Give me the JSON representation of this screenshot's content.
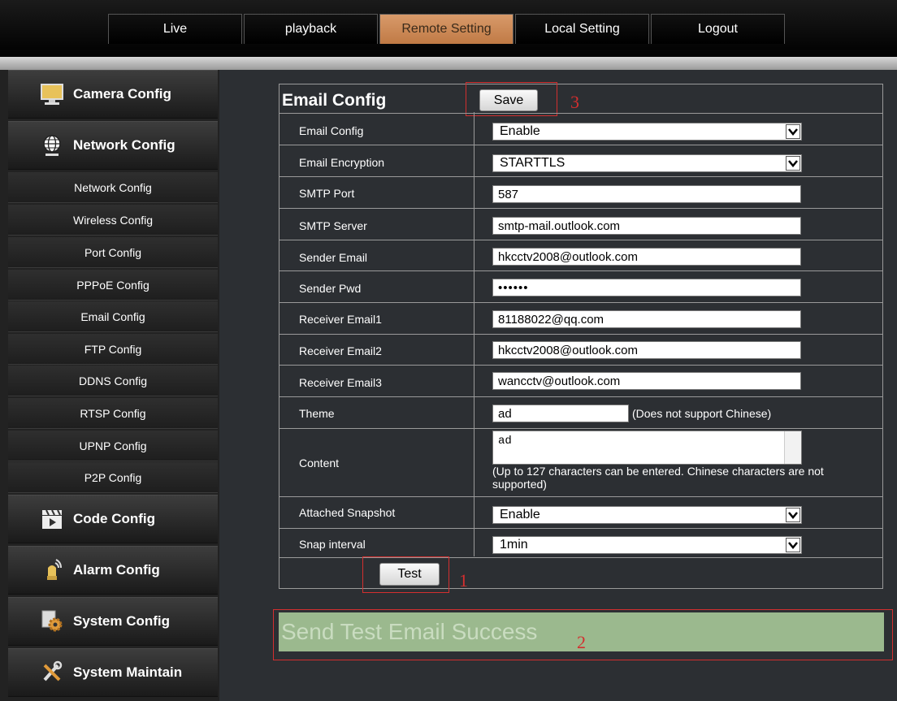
{
  "top_nav": [
    {
      "label": "Live"
    },
    {
      "label": "playback"
    },
    {
      "label": "Remote Setting",
      "active": true
    },
    {
      "label": "Local Setting"
    },
    {
      "label": "Logout"
    }
  ],
  "sidebar": {
    "categories": {
      "camera": {
        "label": "Camera Config",
        "icon": "monitor-icon"
      },
      "network": {
        "label": "Network Config",
        "icon": "globe-icon"
      },
      "code": {
        "label": "Code Config",
        "icon": "clapperboard-icon"
      },
      "alarm": {
        "label": "Alarm Config",
        "icon": "alarm-icon"
      },
      "system": {
        "label": "System Config",
        "icon": "gear-icon"
      },
      "maintain": {
        "label": "System Maintain",
        "icon": "tools-icon"
      }
    },
    "network_items": [
      "Network Config",
      "Wireless Config",
      "Port Config",
      "PPPoE Config",
      "Email Config",
      "FTP Config",
      "DDNS Config",
      "RTSP Config",
      "UPNP Config",
      "P2P Config"
    ]
  },
  "panel": {
    "title": "Email Config",
    "save_label": "Save",
    "test_label": "Test",
    "annotation_save": "3",
    "annotation_test": "1",
    "annotation_success": "2",
    "fields": {
      "email_config": {
        "label": "Email Config",
        "value": "Enable"
      },
      "encryption": {
        "label": "Email Encryption",
        "value": "STARTTLS"
      },
      "smtp_port": {
        "label": "SMTP Port",
        "value": "587"
      },
      "smtp_server": {
        "label": "SMTP Server",
        "value": "smtp-mail.outlook.com"
      },
      "sender_email": {
        "label": "Sender Email",
        "value": "hkcctv2008@outlook.com"
      },
      "sender_pwd": {
        "label": "Sender Pwd",
        "value": "••••••"
      },
      "receiver1": {
        "label": "Receiver Email1",
        "value": "81188022@qq.com"
      },
      "receiver2": {
        "label": "Receiver Email2",
        "value": "hkcctv2008@outlook.com"
      },
      "receiver3": {
        "label": "Receiver Email3",
        "value": "wancctv@outlook.com"
      },
      "theme": {
        "label": "Theme",
        "value": "ad",
        "note": "(Does not support Chinese)"
      },
      "content": {
        "label": "Content",
        "value": "ad",
        "note": "(Up to 127 characters can be entered. Chinese characters are not supported)"
      },
      "snapshot": {
        "label": "Attached Snapshot",
        "value": "Enable"
      },
      "snap_interval": {
        "label": "Snap interval",
        "value": "1min"
      }
    }
  },
  "status_message": "Send Test Email Success",
  "colors": {
    "active_tab": "#c98a55",
    "success_bg": "#9bb98e",
    "annotation_red": "#d32f2f"
  }
}
